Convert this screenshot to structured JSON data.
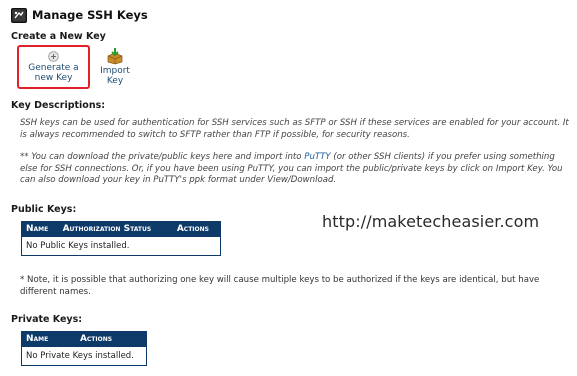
{
  "header": {
    "title": "Manage SSH Keys",
    "icon": "ssh-keys-icon"
  },
  "create": {
    "heading": "Create a New Key",
    "generate_label": "Generate a new Key",
    "import_label": "Import Key"
  },
  "descriptions": {
    "heading": "Key Descriptions:",
    "paragraph1": "SSH keys can be used for authentication for SSH services such as SFTP or SSH if these services are enabled for your account. It is always recommended to switch to SFTP rather than FTP if possible, for security reasons.",
    "p2_before": "** You can download the private/public keys here and import into ",
    "p2_link": "PuTTY",
    "p2_after": " (or other SSH clients) if you prefer using something else for SSH connections. Or, if you have been using PuTTY, you can import the public/private keys by click on Import Key. You can also download your key in PuTTY's ppk format under View/Download."
  },
  "watermark": "http://maketecheasier.com",
  "public_keys": {
    "heading": "Public Keys:",
    "columns": [
      "Name",
      "Authorization Status",
      "Actions"
    ],
    "empty_message": "No Public Keys installed."
  },
  "note": "* Note, it is possible that authorizing one key will cause multiple keys to be authorized if the keys are identical, but have different names.",
  "private_keys": {
    "heading": "Private Keys:",
    "columns": [
      "Name",
      "Actions"
    ],
    "empty_message": "No Private Keys installed."
  },
  "colors": {
    "table_header_bg": "#0e3a6a",
    "highlight_border": "#e0202a",
    "link": "#1e5a9c"
  }
}
